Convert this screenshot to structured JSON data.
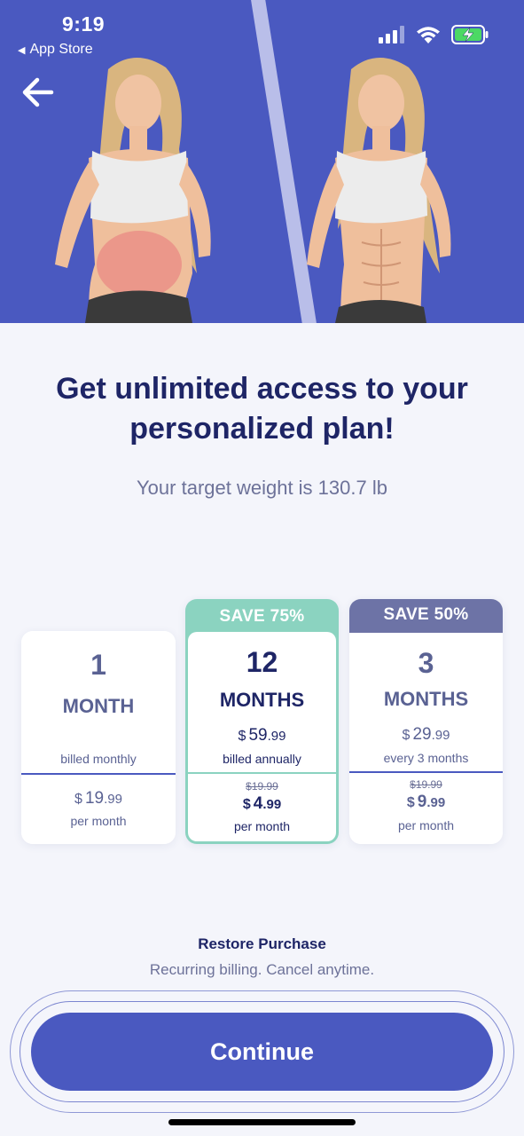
{
  "status_bar": {
    "time": "9:19",
    "back_app_label": "App Store",
    "icons": [
      "cellular-signal-icon",
      "wifi-icon",
      "battery-charging-icon"
    ]
  },
  "nav": {
    "back_icon": "arrow-left-icon"
  },
  "hero": {
    "image": "before-after-illustration"
  },
  "headline": {
    "line1": "Get unlimited access to your",
    "line2": "personalized plan!"
  },
  "subline": "Your target weight is 130.7 lb",
  "plans": [
    {
      "badge": "",
      "count": "1",
      "unit": "MONTH",
      "price_currency": "",
      "price_dollars": "",
      "price_cents": "",
      "billing": "billed monthly",
      "old_price": "",
      "per_month_currency": "$",
      "per_month_dollars": "19",
      "per_month_cents": ".99",
      "per_month_label": "per month"
    },
    {
      "badge": "SAVE 75%",
      "count": "12",
      "unit": "MONTHS",
      "price_currency": "$",
      "price_dollars": "59",
      "price_cents": ".99",
      "billing": "billed annually",
      "old_price": "$19.99",
      "per_month_currency": "$",
      "per_month_dollars": "4",
      "per_month_cents": ".99",
      "per_month_label": "per month",
      "selected": true
    },
    {
      "badge": "SAVE 50%",
      "count": "3",
      "unit": "MONTHS",
      "price_currency": "$",
      "price_dollars": "29",
      "price_cents": ".99",
      "billing": "every 3 months",
      "old_price": "$19.99",
      "per_month_currency": "$",
      "per_month_dollars": "9",
      "per_month_cents": ".99",
      "per_month_label": "per month"
    }
  ],
  "restore_label": "Restore Purchase",
  "recurring_note": "Recurring billing. Cancel anytime.",
  "continue_label": "Continue",
  "colors": {
    "accent": "#4a59c0",
    "selected_border": "#8bd3c0",
    "badge_secondary": "#6d73a6",
    "heading": "#1e2566",
    "background": "#f4f5fb"
  }
}
